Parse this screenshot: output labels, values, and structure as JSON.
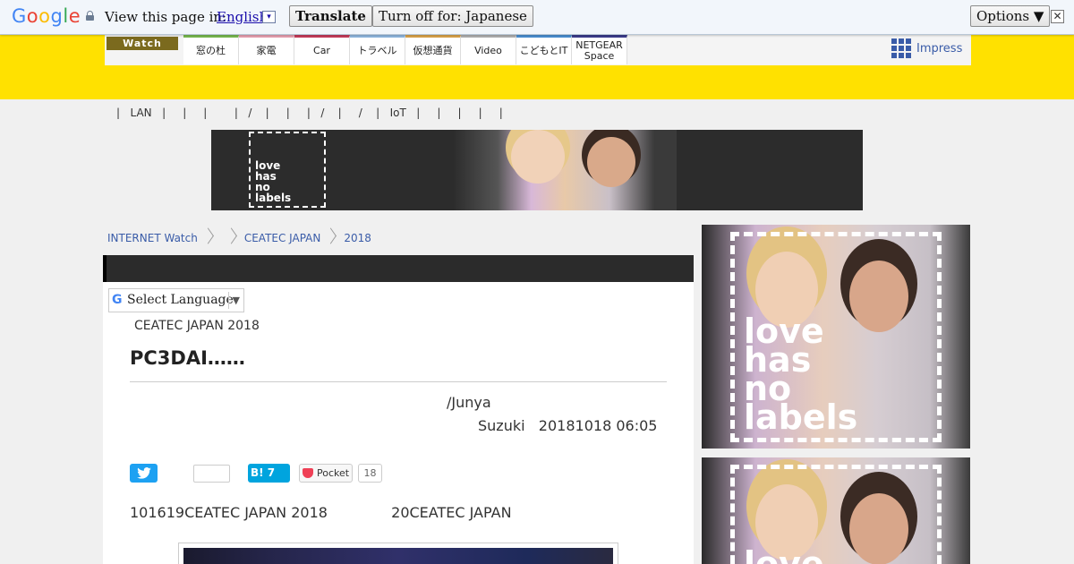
{
  "translate_bar": {
    "logo_letters": [
      {
        "ch": "G",
        "color": "#4285f4"
      },
      {
        "ch": "o",
        "color": "#ea4335"
      },
      {
        "ch": "o",
        "color": "#fbbc05"
      },
      {
        "ch": "g",
        "color": "#4285f4"
      },
      {
        "ch": "l",
        "color": "#34a853"
      },
      {
        "ch": "e",
        "color": "#ea4335"
      }
    ],
    "view_label": "View this page in:",
    "language": "English",
    "language_arrow": "▾",
    "translate_button": "Translate",
    "turn_off_button": "Turn off for: Japanese",
    "options_button": "Options ▼",
    "close_glyph": "✕"
  },
  "header": {
    "logo": "Watch",
    "tabs": [
      {
        "label": "窓の杜",
        "color": "#78b94f"
      },
      {
        "label": "家電",
        "color": "#e8a0b0"
      },
      {
        "label": "Car",
        "color": "#c63c5a"
      },
      {
        "label": "トラベル",
        "color": "#8fb7df"
      },
      {
        "label": "仮想通貨",
        "color": "#d9a24a"
      },
      {
        "label": "Video",
        "color": "#b0b0b0"
      },
      {
        "label": "こどもとIT",
        "color": "#4a8fd1"
      },
      {
        "label": "NETGEAR Space",
        "color": "#3c3c8c"
      }
    ],
    "impress": "Impress"
  },
  "subnav": "|   LAN   |     |     |        |   /    |     |     |   /    |     /    |   IoT   |     |     |     |     |",
  "ad": {
    "lines": [
      "love",
      "has",
      "no",
      "labels"
    ]
  },
  "breadcrumb": [
    "INTERNET Watch",
    "CEATEC JAPAN",
    "2018"
  ],
  "article": {
    "language_select": "Select Language",
    "language_select_arrow": "▼",
    "kicker": "CEATEC JAPAN 2018",
    "title": "PC3DAI……",
    "author": "/Junya",
    "date": "Suzuki   20181018 06:05",
    "hatena_label": "B! 7",
    "pocket_label": "Pocket",
    "pocket_count": "18",
    "lead": "101619CEATEC JAPAN 2018              20CEATEC JAPAN"
  }
}
